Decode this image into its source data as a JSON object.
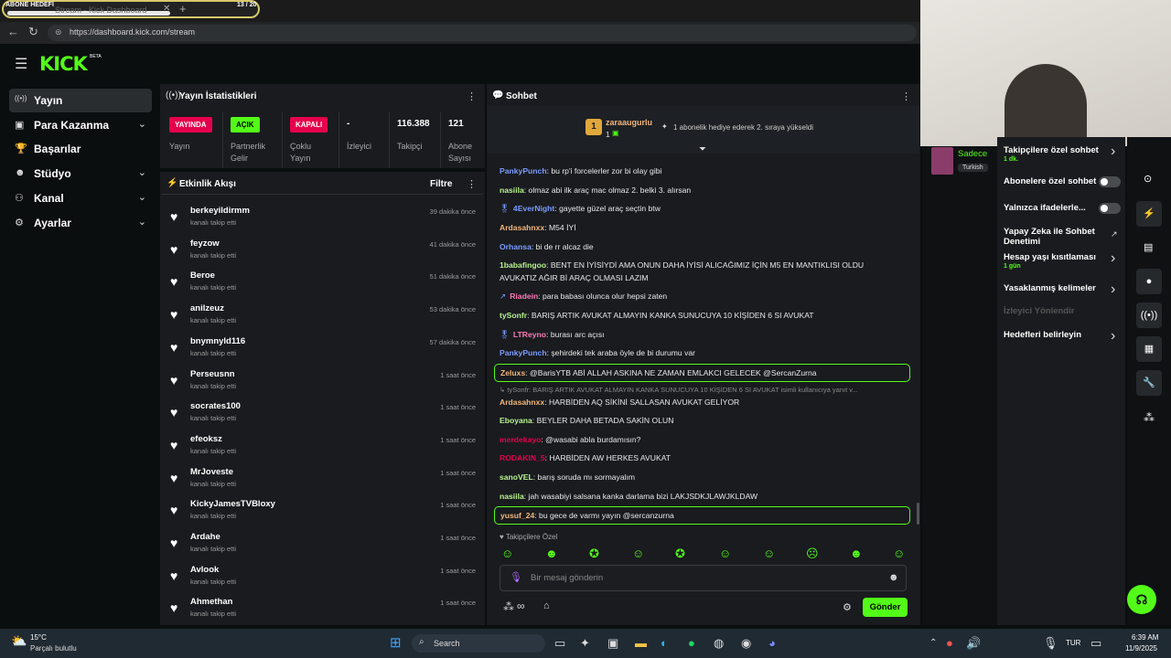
{
  "overlay": {
    "goal_title": "ABONE HEDEFİ",
    "goal_count": "13 / 20",
    "goal_progress": 0.65
  },
  "browser": {
    "tab_label": "Stream - Kick Dashboard",
    "url": "https://dashboard.kick.com/stream"
  },
  "header": {
    "logo": "KICK",
    "logo_badge": "BETA"
  },
  "sidebar": {
    "items": [
      {
        "label": "Yayın",
        "icon": "broadcast-icon",
        "active": true,
        "chevron": false
      },
      {
        "label": "Para Kazanma",
        "icon": "money-icon",
        "active": false,
        "chevron": true
      },
      {
        "label": "Başarılar",
        "icon": "trophy-icon",
        "active": false,
        "chevron": false
      },
      {
        "label": "Stüdyo",
        "icon": "studio-icon",
        "active": false,
        "chevron": true
      },
      {
        "label": "Kanal",
        "icon": "users-icon",
        "active": false,
        "chevron": true
      },
      {
        "label": "Ayarlar",
        "icon": "gear-icon",
        "active": false,
        "chevron": true
      }
    ]
  },
  "stats": {
    "title": "Yayın İstatistikleri",
    "columns": [
      {
        "badge": "YAYINDA",
        "badge_color": "#e5004c",
        "label": "Yayın"
      },
      {
        "badge": "AÇIK",
        "badge_color": "#53fc18",
        "label": "Partnerlik\nGelir"
      },
      {
        "badge": "KAPALI",
        "badge_color": "#e5004c",
        "label": "Çoklu\nYayın"
      },
      {
        "value": "-",
        "label": "İzleyici"
      },
      {
        "value": "116.388",
        "label": "Takipçi"
      },
      {
        "value": "121",
        "label": "Abone\nSayısı"
      }
    ]
  },
  "activity": {
    "title": "Etkinlik Akışı",
    "filter": "Filtre",
    "items": [
      {
        "name": "berkeyildirmm",
        "action": "kanalı takip etti",
        "time": "39 dakika önce"
      },
      {
        "name": "feyzow",
        "action": "kanalı takip etti",
        "time": "41 dakika önce"
      },
      {
        "name": "Beroe",
        "action": "kanalı takip etti",
        "time": "51 dakika önce"
      },
      {
        "name": "anilzeuz",
        "action": "kanalı takip etti",
        "time": "53 dakika önce"
      },
      {
        "name": "bnymnyld116",
        "action": "kanalı takip etti",
        "time": "57 dakika önce"
      },
      {
        "name": "Perseusnn",
        "action": "kanalı takip etti",
        "time": "1 saat önce"
      },
      {
        "name": "socrates100",
        "action": "kanalı takip etti",
        "time": "1 saat önce"
      },
      {
        "name": "efeoksz",
        "action": "kanalı takip etti",
        "time": "1 saat önce"
      },
      {
        "name": "MrJoveste",
        "action": "kanalı takip etti",
        "time": "1 saat önce"
      },
      {
        "name": "KickyJamesTVBloxy",
        "action": "kanalı takip etti",
        "time": "1 saat önce"
      },
      {
        "name": "Ardahe",
        "action": "kanalı takip etti",
        "time": "1 saat önce"
      },
      {
        "name": "Avlook",
        "action": "kanalı takip etti",
        "time": "1 saat önce"
      },
      {
        "name": "Ahmethan",
        "action": "kanalı takip etti",
        "time": "1 saat önce"
      }
    ]
  },
  "chat": {
    "title": "Sohbet",
    "pinned": {
      "rank": "1",
      "user": "zaraaugurlu",
      "count": "1",
      "text": "1 abonelik hediye ederek 2. sıraya yükseldi"
    },
    "messages": [
      {
        "user": "PankyPunch",
        "color": "#7b9cff",
        "text": ": bu rp'i forcelerler zor bi olay gibi"
      },
      {
        "user": "nasiila",
        "color": "#b8f28f",
        "text": ": olmaz abi ilk araç mac olmaz 2. belki 3. alırsan"
      },
      {
        "user": "4EverNight",
        "color": "#7b9cff",
        "text": ": gayette güzel araç seçtin btw",
        "badge": "🎖"
      },
      {
        "user": "Ardasahnxx",
        "color": "#f2b67b",
        "text": ": M54 İYİ"
      },
      {
        "user": "Orhansa",
        "color": "#7b9cff",
        "text": ": bi de rr alcaz die"
      },
      {
        "user": "1babafingoo",
        "color": "#b8f28f",
        "text": ": BENT EN İYİSİYDİ AMA ONUN DAHA İYİSİ ALICAĞIMIZ İÇİN M5 EN MANTIKLISI OLDU"
      },
      {
        "user": "",
        "color": "#ffffff",
        "text": "AVUKATIZ AĞIR Bİ ARAÇ OLMASI LAZIM"
      },
      {
        "user": "Riadein",
        "color": "#ff7ab8",
        "text": ": para babası olunca olur hepsi zaten",
        "badge": "↗"
      },
      {
        "user": "tySonfr",
        "color": "#b8f28f",
        "text": ": BARIŞ ARTIK AVUKAT ALMAYIN KANKA SUNUCUYA 10 KİŞİDEN 6 SI AVUKAT"
      },
      {
        "user": "LTReyno",
        "color": "#ff7ab8",
        "text": ": burası arc açısı",
        "badge": "🎖"
      },
      {
        "user": "PankyPunch",
        "color": "#7b9cff",
        "text": ": şehirdeki tek araba öyle de bi durumu var"
      }
    ],
    "highlight1": {
      "user": "Zeluxs",
      "color": "#f2b67b",
      "text": ": @BarisYTB ABİ ALLAH ASKINA NE ZAMAN EMLAKCI GELECEK @SercanZurna"
    },
    "reply_hint": "↳ tySonfr: BARIŞ ARTIK AVUKAT ALMAYIN KANKA SUNUCUYA 10 KİŞİDEN 6 SI AVUKAT isimli kullanıcıya yanıt v...",
    "messages2": [
      {
        "user": "Ardasahnxx",
        "color": "#f2b67b",
        "text": ": HARBİDEN AQ SİKİNİ SALLASAN AVUKAT GELİYOR"
      },
      {
        "user": "Eboyana",
        "color": "#b8f28f",
        "text": ": BEYLER DAHA BETADA SAKİN OLUN"
      },
      {
        "user": "merdekayo",
        "color": "#e5004c",
        "text": ": @wasabi abla burdamısın?"
      },
      {
        "user": "RODAKIN_5",
        "color": "#e5004c",
        "text": ": HARBİDEN AW HERKES AVUKAT"
      },
      {
        "user": "sanoVEL",
        "color": "#b8f28f",
        "text": ": barış soruda mı sormayalım"
      },
      {
        "user": "nasiila",
        "color": "#b8f28f",
        "text": ": jah wasabiyi salsana kanka darlama bizi LAKJSDKJLAWJKLDAW"
      }
    ],
    "highlight2": {
      "user": "yusuf_24",
      "color": "#f2b67b",
      "text": ": bu gece de varmı yayın @sercanzurna"
    },
    "emote_section": "♥ Takipçilere Özel",
    "input_placeholder": "Bir mesaj gönderin",
    "send_label": "Gönder"
  },
  "preview": {
    "channel": "Sadece",
    "lang": "Turkish"
  },
  "settings": {
    "items": [
      {
        "label": "Takipçilere özel sohbet",
        "sub": "1 dk.",
        "type": "chevron"
      },
      {
        "label": "Abonelere özel sohbet",
        "type": "toggle"
      },
      {
        "label": "Yalnızca ifadelerle...",
        "type": "toggle"
      },
      {
        "label": "Yapay Zeka ile Sohbet Denetimi",
        "type": "external"
      },
      {
        "label": "Hesap yaşı kısıtlaması",
        "sub": "1 gün",
        "type": "chevron"
      },
      {
        "label": "Yasaklanmış kelimeler",
        "type": "chevron"
      },
      {
        "label": "İzleyici Yönlendir",
        "type": "disabled"
      },
      {
        "label": "Hedefleri belirleyin",
        "type": "chevron"
      }
    ]
  },
  "taskbar": {
    "weather_temp": "15°C",
    "weather_desc": "Parçalı bulutlu",
    "search": "Search",
    "lang": "TUR",
    "time": "6:39 AM",
    "date": "11/9/2025"
  }
}
